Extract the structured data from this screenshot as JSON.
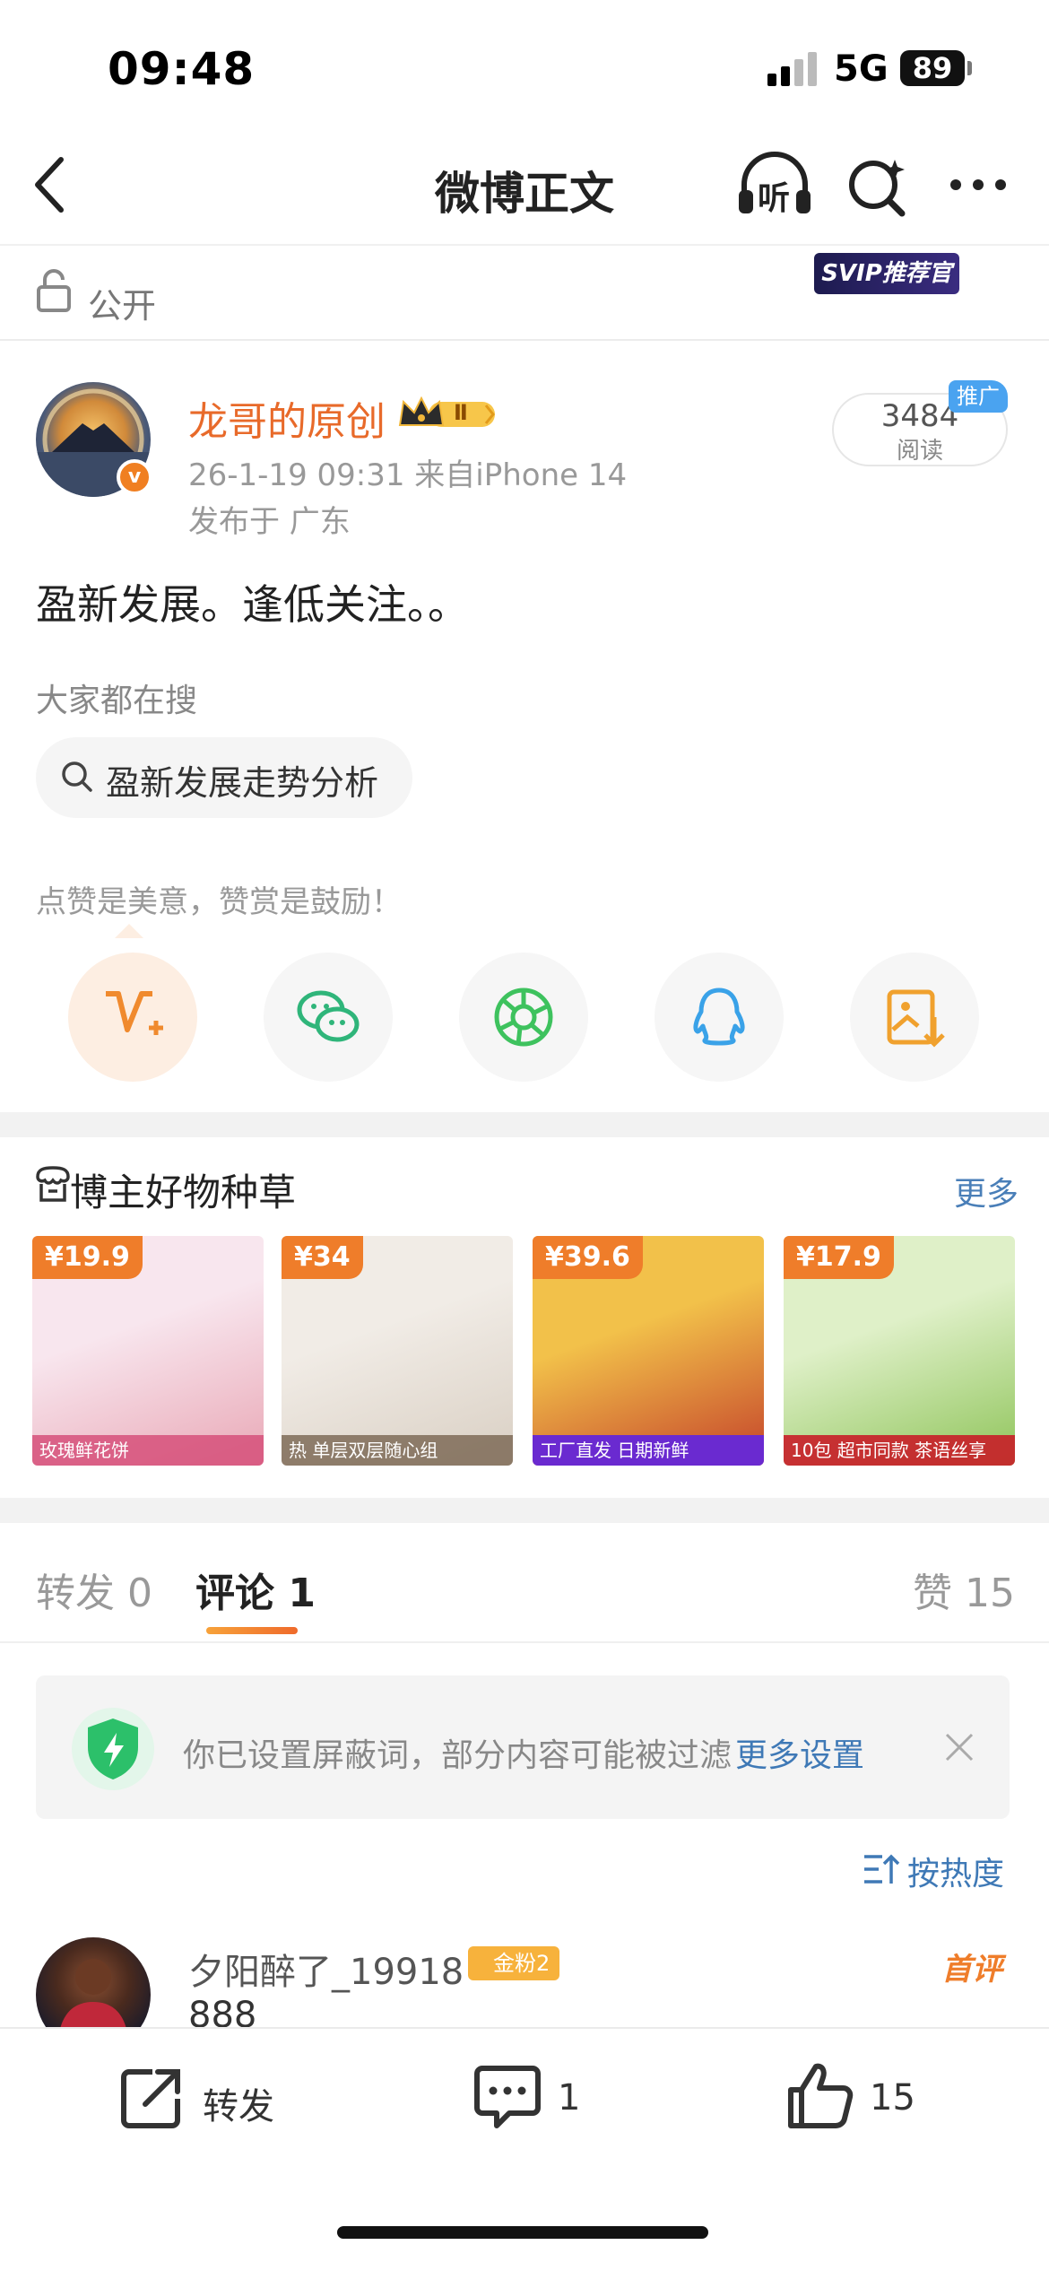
{
  "status_bar": {
    "time": "09:48",
    "network": "5G",
    "battery": "89"
  },
  "nav": {
    "title": "微博正文",
    "listen_label": "听"
  },
  "visibility": {
    "label": "公开",
    "svip_badge": "SVIP推荐官"
  },
  "post": {
    "author": "龙哥的原创",
    "crown_level": "Ⅱ",
    "date_source": "26-1-19 09:31  来自iPhone 14",
    "location": "发布于 广东",
    "reads_count": "3484",
    "reads_label": "阅读",
    "promo_badge": "推广",
    "text": "盈新发展。逢低关注。。",
    "search_hint": "大家都在搜",
    "search_pill": "盈新发展走势分析",
    "reward_hint": "点赞是美意，赞赏是鼓励！"
  },
  "share": [
    "weibo-reward",
    "wechat",
    "moments",
    "qq",
    "save-image"
  ],
  "goods": {
    "title": "博主好物种草",
    "more": "更多",
    "items": [
      {
        "price": "¥19.9",
        "caption": "玫瑰鲜花饼",
        "colors": [
          "#f8e6ee",
          "#e9a8b6"
        ]
      },
      {
        "price": "¥34",
        "caption": "热 单层双层随心组",
        "colors": [
          "#f1ece6",
          "#d9cfc3"
        ]
      },
      {
        "price": "¥39.6",
        "caption": "工厂直发 日期新鲜",
        "colors": [
          "#f2c14a",
          "#c4422a"
        ]
      },
      {
        "price": "¥17.9",
        "caption": "10包 超市同款 茶语丝享",
        "colors": [
          "#dff0c8",
          "#8fc45a"
        ]
      }
    ]
  },
  "tabs": {
    "repost": "转发 0",
    "comment": "评论 1",
    "like": "赞 15"
  },
  "filter": {
    "text": "你已设置屏蔽词，部分内容可能被过滤",
    "link": "更多设置"
  },
  "sort_label": "按热度",
  "comment": {
    "user": "夕阳醉了_19918",
    "badge": "金粉2",
    "tag": "首评",
    "text": "888"
  },
  "bottom_bar": {
    "repost": "转发",
    "comment_count": "1",
    "like_count": "15"
  }
}
